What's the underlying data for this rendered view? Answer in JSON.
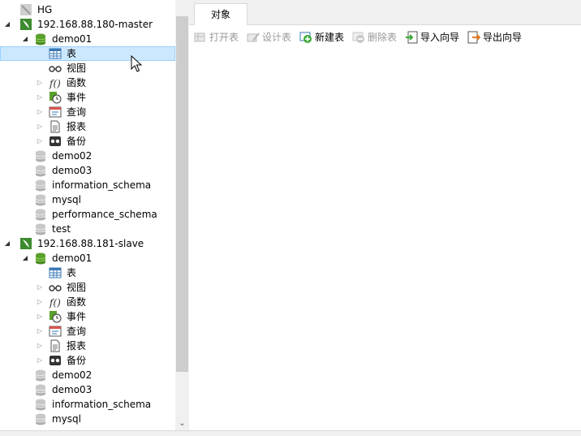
{
  "tree": {
    "root": "HG",
    "connections": [
      {
        "name": "192.168.88.180-master",
        "databases": [
          {
            "name": "demo01",
            "items": [
              {
                "label": "表",
                "icon": "table-icon",
                "selected": true
              },
              {
                "label": "视图",
                "icon": "view-glasses-icon"
              },
              {
                "label": "函数",
                "icon": "function-icon"
              },
              {
                "label": "事件",
                "icon": "event-clock-icon"
              },
              {
                "label": "查询",
                "icon": "query-icon"
              },
              {
                "label": "报表",
                "icon": "report-icon"
              },
              {
                "label": "备份",
                "icon": "backup-icon"
              }
            ]
          },
          {
            "name": "demo02"
          },
          {
            "name": "demo03"
          },
          {
            "name": "information_schema"
          },
          {
            "name": "mysql"
          },
          {
            "name": "performance_schema"
          },
          {
            "name": "test"
          }
        ]
      },
      {
        "name": "192.168.88.181-slave",
        "databases": [
          {
            "name": "demo01",
            "items": [
              {
                "label": "表",
                "icon": "table-icon"
              },
              {
                "label": "视图",
                "icon": "view-glasses-icon"
              },
              {
                "label": "函数",
                "icon": "function-icon"
              },
              {
                "label": "事件",
                "icon": "event-clock-icon"
              },
              {
                "label": "查询",
                "icon": "query-icon"
              },
              {
                "label": "报表",
                "icon": "report-icon"
              },
              {
                "label": "备份",
                "icon": "backup-icon"
              }
            ]
          },
          {
            "name": "demo02"
          },
          {
            "name": "demo03"
          },
          {
            "name": "information_schema"
          },
          {
            "name": "mysql"
          }
        ]
      }
    ]
  },
  "tabs": [
    {
      "label": "对象"
    }
  ],
  "toolbar": {
    "open_table": "打开表",
    "design_table": "设计表",
    "new_table": "新建表",
    "delete_table": "删除表",
    "import_wizard": "导入向导",
    "export_wizard": "导出向导"
  },
  "colors": {
    "selection": "#cce8ff",
    "db_icon": "#5aa02c",
    "connection_icon": "#3c8a2e"
  }
}
